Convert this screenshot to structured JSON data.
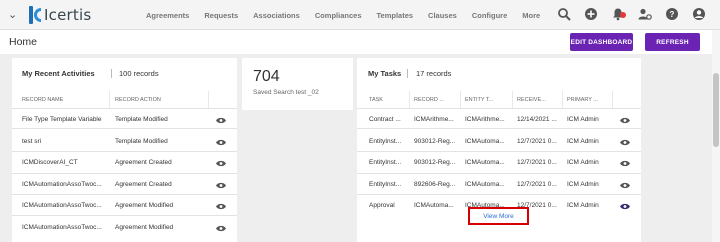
{
  "nav": {
    "brand": "Icertis",
    "links": [
      "Agreements",
      "Requests",
      "Associations",
      "Compliances",
      "Templates",
      "Clauses",
      "Configure",
      "More"
    ]
  },
  "header": {
    "title": "Home",
    "edit_dashboard": "EDIT DASHBOARD",
    "refresh": "REFRESH"
  },
  "recent": {
    "title": "My Recent Activities",
    "count": "100 records",
    "columns": [
      "RECORD NAME",
      "RECORD ACTION"
    ],
    "rows": [
      {
        "name": "File Type Template Variable",
        "action": "Template Modified"
      },
      {
        "name": "test sri",
        "action": "Template Modified"
      },
      {
        "name": "ICMDiscoverAI_CT",
        "action": "Agreement Created"
      },
      {
        "name": "ICMAutomationAssoTwoc...",
        "action": "Agreement Created"
      },
      {
        "name": "ICMAutomationAssoTwoc...",
        "action": "Agreement Modified"
      },
      {
        "name": "ICMAutomationAssoTwoc...",
        "action": "Agreement Modified"
      }
    ]
  },
  "saved_search": {
    "value": "704",
    "label": "Saved Search test _02"
  },
  "tasks": {
    "title": "My Tasks",
    "count": "17 records",
    "columns": [
      "TASK",
      "RECORD ...",
      "ENTITY T...",
      "RECEIVE...",
      "PRIMARY ..."
    ],
    "rows": [
      {
        "task": "Contract ...",
        "record": "ICMArithme...",
        "entity": "ICMArithme...",
        "received": "12/14/2021 ...",
        "primary": "ICM Admin"
      },
      {
        "task": "EntityInst...",
        "record": "903012-Reg...",
        "entity": "ICMAutoma...",
        "received": "12/7/2021 0...",
        "primary": "ICM Admin"
      },
      {
        "task": "EntityInst...",
        "record": "903012-Reg...",
        "entity": "ICMAutoma...",
        "received": "12/7/2021 0...",
        "primary": "ICM Admin"
      },
      {
        "task": "EntityInst...",
        "record": "892606-Reg...",
        "entity": "ICMAutoma...",
        "received": "12/7/2021 0...",
        "primary": "ICM Admin"
      },
      {
        "task": "Approval",
        "record": "ICMAutoma...",
        "entity": "ICMAutoma...",
        "received": "12/7/2021 0...",
        "primary": "ICM Admin"
      }
    ],
    "view_more": "View More"
  },
  "colors": {
    "accent": "#6a23b2",
    "link": "#2a6fd6",
    "highlight": "#d60000"
  }
}
